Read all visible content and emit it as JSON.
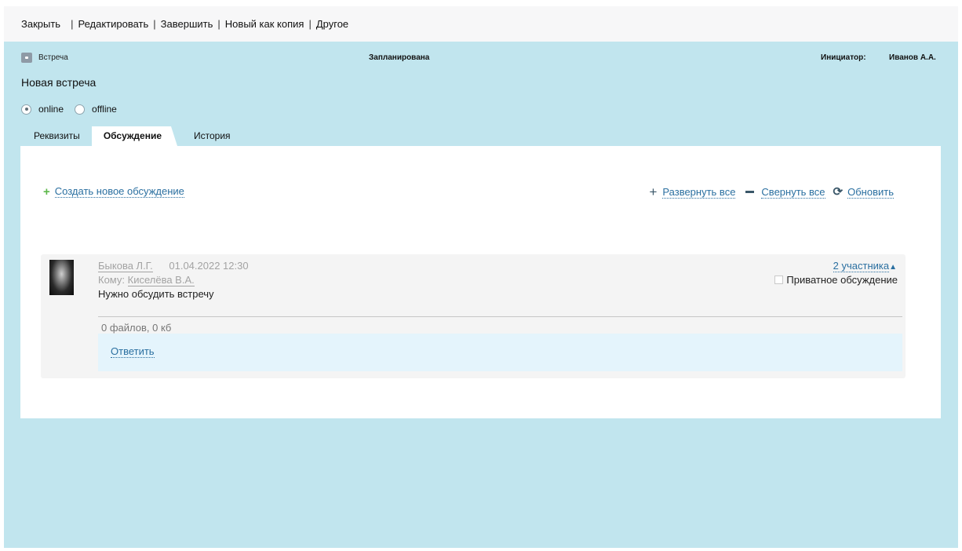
{
  "toolbar": {
    "items": [
      "Закрыть",
      "Редактировать",
      "Завершить",
      "Новый как копия",
      "Другое"
    ]
  },
  "header": {
    "type_label": "Встреча",
    "status": "Запланирована",
    "initiator_label": "Инициатор:",
    "initiator_value": "Иванов А.А.",
    "title": "Новая встреча"
  },
  "mode": {
    "options": [
      "online",
      "offline"
    ],
    "selected": "online"
  },
  "tabs": [
    "Реквизиты",
    "Обсуждение",
    "История"
  ],
  "active_tab": "Обсуждение",
  "discussion": {
    "create_label": "Создать новое обсуждение",
    "expand_label": "Развернуть все",
    "collapse_label": "Свернуть все",
    "refresh_label": "Обновить",
    "card": {
      "author": "Быкова Л.Г.",
      "date": "01.04.2022 12:30",
      "to_label": "Кому:",
      "to_name": "Киселёва В.А.",
      "message": "Нужно обсудить встречу",
      "participants": "2 участника",
      "private_label": "Приватное обсуждение",
      "private_checked": false,
      "files": "0 файлов, 0 кб",
      "reply_label": "Ответить"
    }
  },
  "icons": {
    "type": "meeting-icon",
    "create": "plus-icon",
    "expand": "plus-icon",
    "collapse": "minus-icon",
    "refresh": "refresh-icon",
    "participants": "triangle-up-icon"
  },
  "colors": {
    "background": "#c1e5ee",
    "link": "#2a6fa0",
    "plus_green": "#5db84b",
    "reply_bg": "#e4f4fc"
  }
}
